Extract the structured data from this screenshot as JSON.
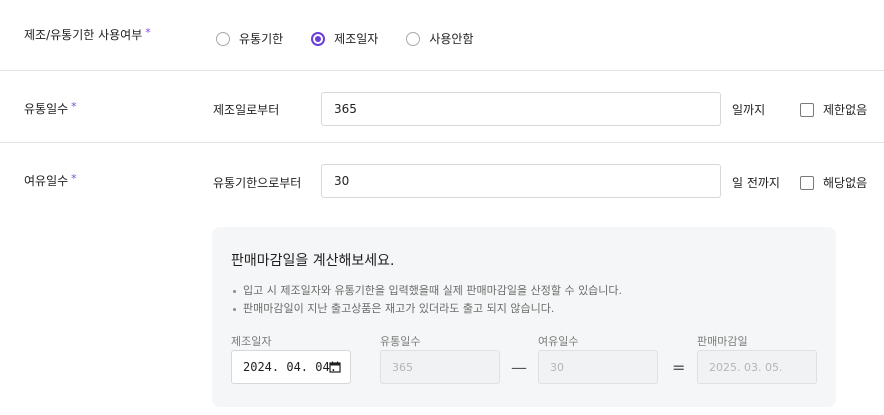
{
  "mfg_usage": {
    "label": "제조/유통기한 사용여부",
    "required_mark": "*",
    "options": [
      {
        "label": "유통기한",
        "checked": false
      },
      {
        "label": "제조일자",
        "checked": true
      },
      {
        "label": "사용안함",
        "checked": false
      }
    ]
  },
  "shelf_days": {
    "label": "유통일수",
    "required_mark": "*",
    "sub_label": "제조일로부터",
    "value": "365",
    "suffix": "일까지",
    "checkbox_label": "제한없음"
  },
  "margin_days": {
    "label": "여유일수",
    "required_mark": "*",
    "sub_label": "유통기한으로부터",
    "value": "30",
    "suffix": "일 전까지",
    "checkbox_label": "해당없음"
  },
  "calculator": {
    "title": "판매마감일을 계산해보세요.",
    "bullets": [
      "입고 시 제조일자와 유통기한을 입력했을때 실제 판매마감일을 산정할 수 있습니다.",
      "판매마감일이 지난 출고상품은 재고가 있더라도 출고 되지 않습니다."
    ],
    "fields": [
      {
        "label": "제조일자",
        "value": "2024. 04. 04."
      },
      {
        "label": "유통일수",
        "value": "365"
      },
      {
        "label": "여유일수",
        "value": "30"
      },
      {
        "label": "판매마감일",
        "value": "2025. 03. 05."
      }
    ],
    "minus_op": "—",
    "equals_op": "="
  },
  "colors": {
    "accent": "#6a3fd8",
    "required": "#7b4ae2",
    "divider": "#e3e3e3",
    "panel": "#f5f6f7"
  }
}
